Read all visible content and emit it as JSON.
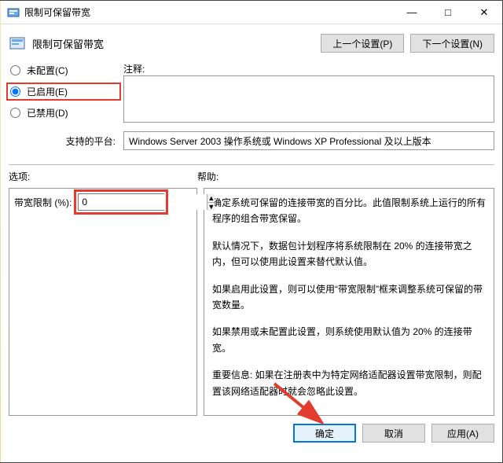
{
  "window": {
    "title": "限制可保留带宽"
  },
  "header": {
    "title": "限制可保留带宽",
    "prev_btn": "上一个设置(P)",
    "next_btn": "下一个设置(N)"
  },
  "radios": {
    "not_configured": "未配置(C)",
    "enabled": "已启用(E)",
    "disabled": "已禁用(D)",
    "selected": "enabled"
  },
  "comment": {
    "label": "注释:",
    "value": ""
  },
  "platform": {
    "label": "支持的平台:",
    "value": "Windows Server 2003 操作系统或 Windows XP Professional 及以上版本"
  },
  "sections": {
    "options_label": "选项:",
    "help_label": "帮助:"
  },
  "options": {
    "bandwidth_label": "带宽限制 (%):",
    "bandwidth_value": "0"
  },
  "help_paragraphs": [
    "确定系统可保留的连接带宽的百分比。此值限制系统上运行的所有程序的组合带宽保留。",
    "默认情况下，数据包计划程序将系统限制在 20% 的连接带宽之内，但可以使用此设置来替代默认值。",
    "如果启用此设置，则可以使用“带宽限制”框来调整系统可保留的带宽数量。",
    "如果禁用或未配置此设置，则系统使用默认值为 20% 的连接带宽。",
    "重要信息: 如果在注册表中为特定网络适配器设置带宽限制，则配置该网络适配器时就会忽略此设置。"
  ],
  "buttons": {
    "ok": "确定",
    "cancel": "取消",
    "apply": "应用(A)"
  },
  "icons": {
    "app": "app-icon",
    "minimize": "minimize-icon",
    "maximize": "maximize-icon",
    "close": "close-icon",
    "spin_up": "spin-up-icon",
    "spin_down": "spin-down-icon"
  }
}
